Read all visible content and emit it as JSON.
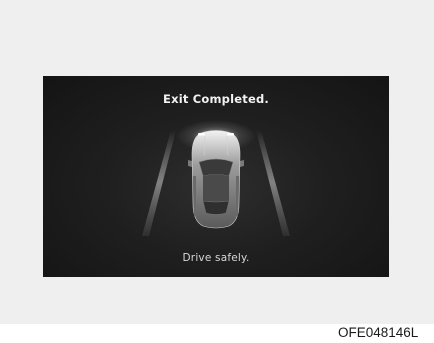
{
  "screen": {
    "title": "Exit Completed.",
    "subtitle": "Drive safely."
  },
  "icons": {
    "vehicle": "car-top-view-icon",
    "lanes": "parking-lane-lines-icon"
  },
  "figure_code": "OFE048146L",
  "colors": {
    "screen_background": "#1a1a1a",
    "page_background": "#efefef",
    "screen_text": "#f2f2f2"
  }
}
